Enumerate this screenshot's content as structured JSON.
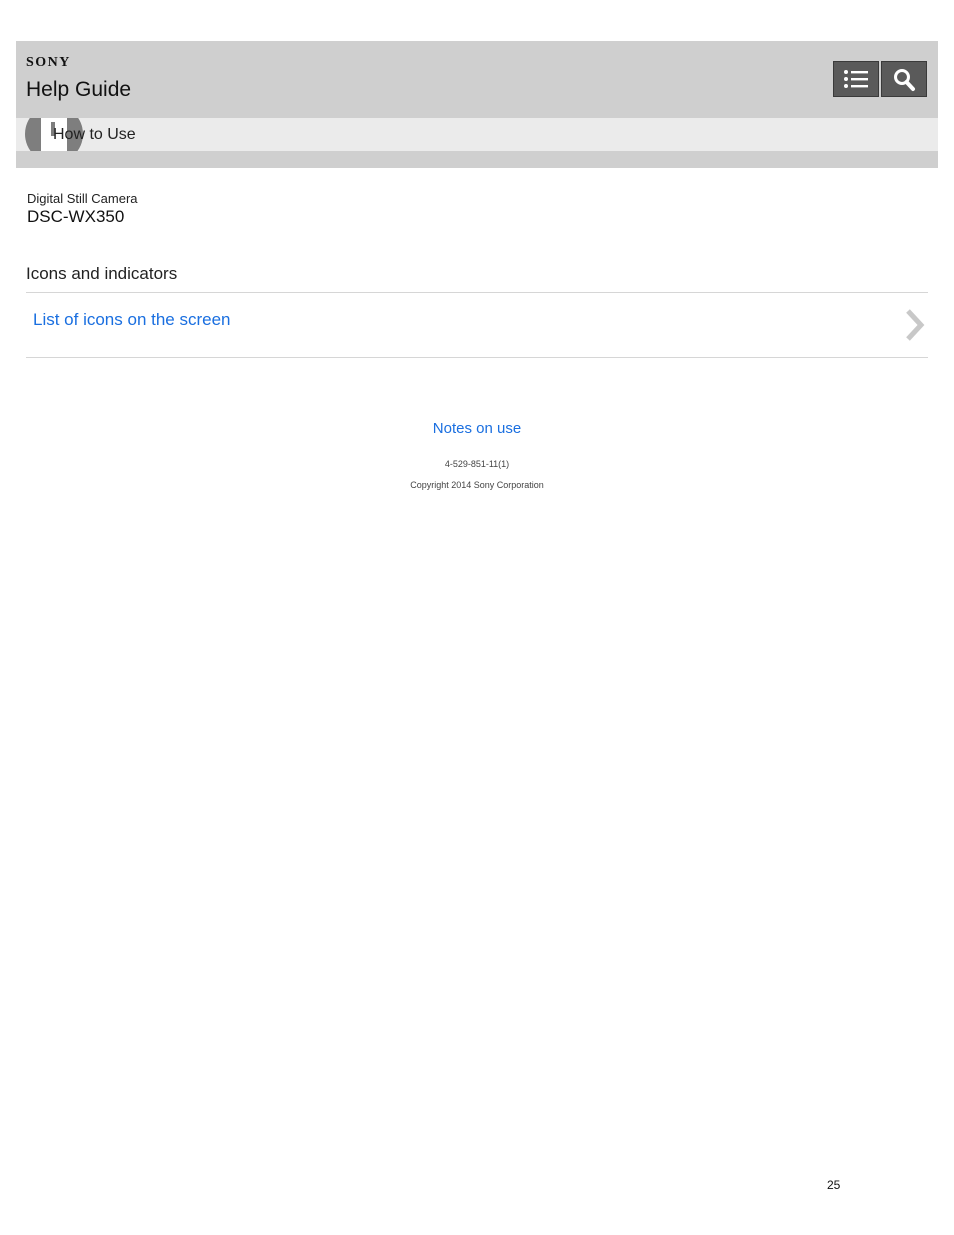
{
  "header": {
    "brand": "SONY",
    "title": "Help Guide",
    "toc_button_icon": "list-icon",
    "search_button_icon": "search-icon",
    "bg_color": "#cfcfcf",
    "button_color": "#5a5a5a"
  },
  "subbar": {
    "icon": "how-to-use-icon",
    "label": "How to Use",
    "bg_color": "#ebebeb"
  },
  "product": {
    "category": "Digital Still Camera",
    "model": "DSC-WX350"
  },
  "section": {
    "heading": "Icons and indicators",
    "items": [
      {
        "label": "List of icons on the screen",
        "icon": "chevron-right-icon"
      }
    ]
  },
  "footer": {
    "notes_link": "Notes on use",
    "doc_number": "4-529-851-11(1)",
    "copyright": "Copyright 2014 Sony Corporation",
    "link_color": "#1a6fe0"
  },
  "page_number": "25"
}
